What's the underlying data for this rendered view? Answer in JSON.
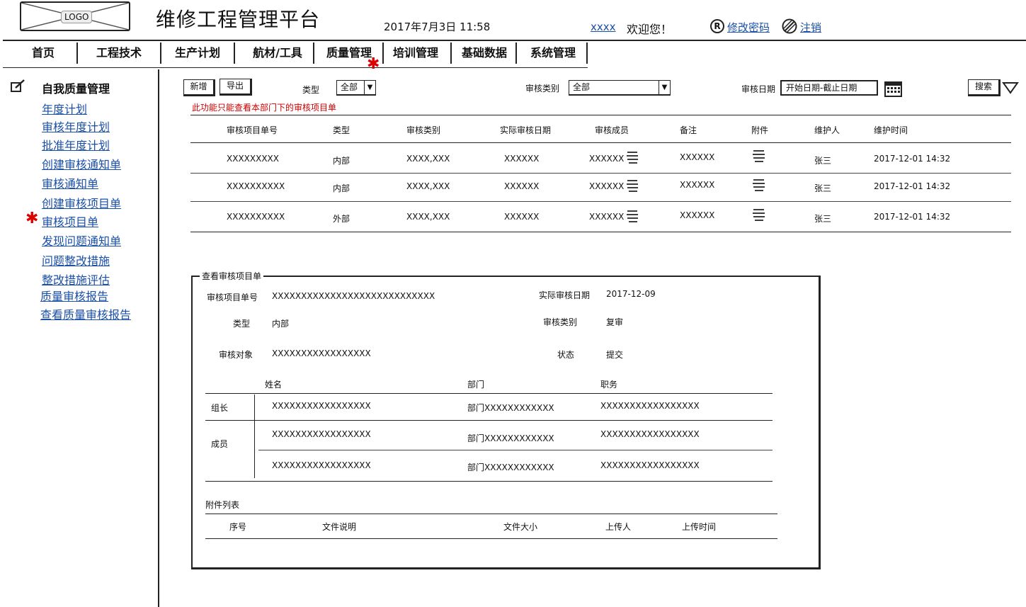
{
  "header": {
    "logo_text": "LOGO",
    "app_title": "维修工程管理平台",
    "datetime": "2017年7月3日  11:58",
    "username": "xxxx",
    "welcome": "欢迎您！",
    "change_password": "修改密码",
    "logout": "注销"
  },
  "nav": {
    "items": [
      "首页",
      "工程技术",
      "生产计划",
      "航材/工具",
      "质量管理",
      "培训管理",
      "基础数据",
      "系统管理"
    ],
    "active_index": 4
  },
  "sidebar": {
    "title": "自我质量管理",
    "items": [
      "年度计划",
      "审核年度计划",
      "批准年度计划",
      "创建审核通知单",
      "审核通知单",
      "创建审核项目单",
      "审核项目单",
      "发现问题通知单",
      "问题整改措施",
      "整改措施评估",
      "质量审核报告",
      "查看质量审核报告"
    ],
    "active_index": 6
  },
  "toolbar": {
    "new_label": "新增",
    "export_label": "导出",
    "type_label": "类型",
    "type_value": "全部",
    "audit_category_label": "审核类别",
    "audit_category_value": "全部",
    "audit_date_label": "审核日期",
    "audit_date_placeholder": "开始日期-截止日期",
    "search_label": "搜索"
  },
  "notice": "此功能只能查看本部门下的审核项目单",
  "table": {
    "columns": [
      "审核项目单号",
      "类型",
      "审核类别",
      "实际审核日期",
      "审核成员",
      "备注",
      "附件",
      "维护人",
      "维护时间"
    ],
    "rows": [
      [
        "XXXXXXXXX",
        "内部",
        "XXXX,XXX",
        "XXXXXX",
        "XXXXXX",
        "XXXXXX",
        "",
        "张三",
        "2017-12-01 14:32"
      ],
      [
        "XXXXXXXXXX",
        "内部",
        "XXXX,XXX",
        "XXXXXX",
        "XXXXXX",
        "XXXXXX",
        "",
        "张三",
        "2017-12-01 14:32"
      ],
      [
        "XXXXXXXXXX",
        "外部",
        "XXXX,XXX",
        "XXXXXX",
        "XXXXXX",
        "XXXXXX",
        "",
        "张三",
        "2017-12-01 14:32"
      ]
    ]
  },
  "detail": {
    "legend": "查看审核项目单",
    "fields": {
      "order_no_label": "审核项目单号",
      "order_no_value": "XXXXXXXXXXXXXXXXXXXXXXXXXXXX",
      "actual_date_label": "实际审核日期",
      "actual_date_value": "2017-12-09",
      "type_label": "类型",
      "type_value": "内部",
      "category_label": "审核类别",
      "category_value": "复审",
      "target_label": "审核对象",
      "target_value": "XXXXXXXXXXXXXXXXX",
      "status_label": "状态",
      "status_value": "提交"
    },
    "members": {
      "columns": [
        "姓名",
        "部门",
        "职务"
      ],
      "leader_label": "组长",
      "member_label": "成员",
      "rows": [
        [
          "XXXXXXXXXXXXXXXXX",
          "部门XXXXXXXXXXXX",
          "XXXXXXXXXXXXXXXXX"
        ],
        [
          "XXXXXXXXXXXXXXXXX",
          "部门XXXXXXXXXXXX",
          "XXXXXXXXXXXXXXXXX"
        ],
        [
          "XXXXXXXXXXXXXXXXX",
          "部门XXXXXXXXXXXX",
          "XXXXXXXXXXXXXXXXX"
        ]
      ]
    },
    "attachments": {
      "title": "附件列表",
      "columns": [
        "序号",
        "文件说明",
        "文件大小",
        "上传人",
        "上传时间"
      ]
    }
  },
  "colors": {
    "link": "#1a4fa8",
    "accent_star": "#dd0000",
    "notice": "#cc0000"
  }
}
